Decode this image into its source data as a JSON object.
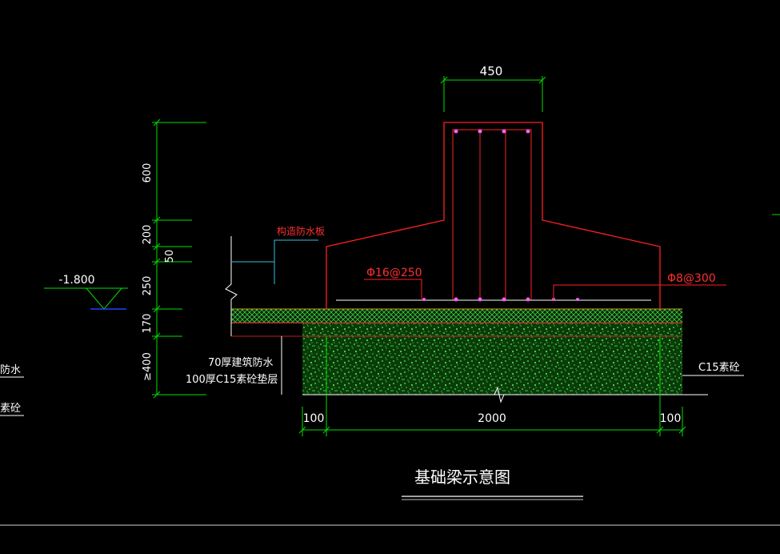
{
  "colors": {
    "background": "#000000",
    "dimension": "#00e000",
    "concrete": "#ff2020",
    "text": "#ffffff",
    "annotation_red": "#ff3030",
    "leader_cyan": "#30c0e0",
    "water_blue": "#2040ff",
    "hatch_green": "#2ebd2e",
    "hatch_olive": "#a0b020"
  },
  "dimensions": {
    "top_width": "450",
    "bottom_total": "2000",
    "bottom_left_offset": "100",
    "bottom_right_offset": "100",
    "vertical": [
      "600",
      "200",
      "50",
      "250",
      "170",
      "≥400"
    ]
  },
  "annotations": {
    "level": "-1.800",
    "waterproof_board": "构造防水板",
    "rebar_left": "Φ16@250",
    "rebar_right": "Φ8@300",
    "layer_waterproof": "70厚建筑防水",
    "layer_cushion": "100厚C15素砼垫层",
    "plain_concrete": "C15素砼",
    "left_edge_1": "防水",
    "left_edge_2": "素砼"
  },
  "title": "基础梁示意图"
}
